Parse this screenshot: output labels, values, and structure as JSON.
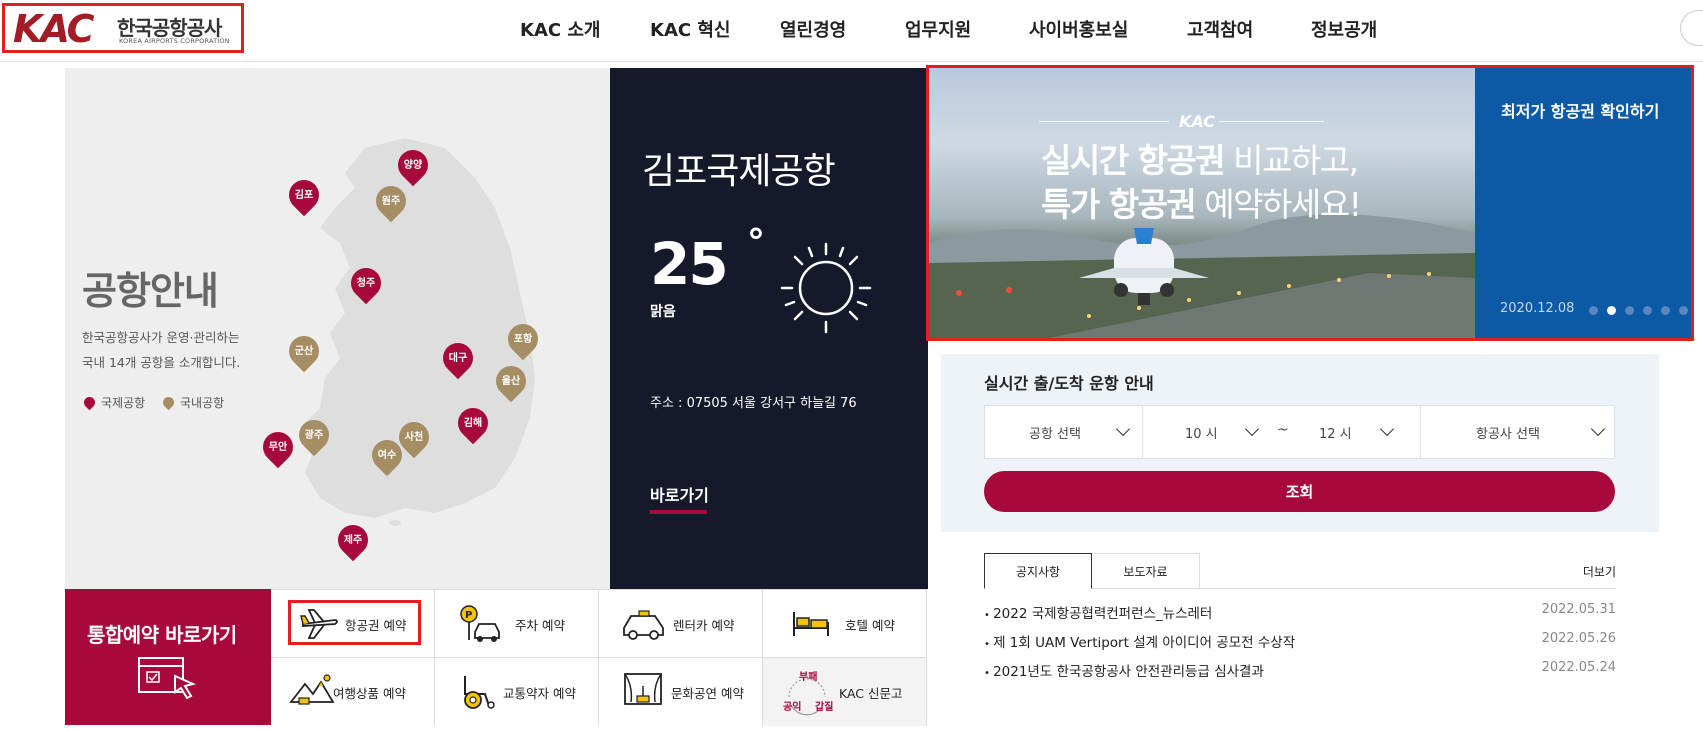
{
  "header": {
    "logo_mark": "KAC",
    "logo_korean": "한국공항공사",
    "logo_english": "KOREA AIRPORTS CORPORATION",
    "nav": [
      "KAC 소개",
      "KAC 혁신",
      "열린경영",
      "업무지원",
      "사이버홍보실",
      "고객참여",
      "정보공개"
    ]
  },
  "map_panel": {
    "title": "공항안내",
    "desc_line1": "한국공항공사가 운영·관리하는",
    "desc_line2": "국내 14개 공항을 소개합니다.",
    "legend_international": "국제공항",
    "legend_domestic": "국내공항",
    "airports": [
      {
        "name": "김포",
        "type": "international"
      },
      {
        "name": "양양",
        "type": "international"
      },
      {
        "name": "원주",
        "type": "domestic"
      },
      {
        "name": "청주",
        "type": "international"
      },
      {
        "name": "군산",
        "type": "domestic"
      },
      {
        "name": "포항",
        "type": "domestic"
      },
      {
        "name": "대구",
        "type": "international"
      },
      {
        "name": "울산",
        "type": "domestic"
      },
      {
        "name": "김해",
        "type": "international"
      },
      {
        "name": "광주",
        "type": "domestic"
      },
      {
        "name": "사천",
        "type": "domestic"
      },
      {
        "name": "무안",
        "type": "international"
      },
      {
        "name": "여수",
        "type": "domestic"
      },
      {
        "name": "제주",
        "type": "international"
      }
    ],
    "colors": {
      "international": "#a70a3a",
      "domestic": "#a68e64"
    }
  },
  "airport_panel": {
    "name": "김포국제공항",
    "temperature": "25",
    "degree_symbol": "°",
    "weather": "맑음",
    "address": "주소 : 07505 서울 강서구 하늘길 76",
    "shortcut": "바로가기"
  },
  "banner": {
    "mark": "KAC",
    "line1_bold": "실시간 항공권",
    "line1_rest": " 비교하고,",
    "line2_bold": "특가 항공권",
    "line2_rest": " 예약하세요!",
    "cta": "최저가 항공권 확인하기",
    "date": "2020.12.08",
    "slide_count": 6,
    "active_slide": 2,
    "accent_color": "#0c5aa6"
  },
  "flight_info": {
    "title": "실시간 출/도착 운항 안내",
    "airport_select": "공항 선택",
    "time_from": "10 시",
    "tilde": "~",
    "time_to": "12 시",
    "airline_select": "항공사 선택",
    "search_button": "조회"
  },
  "notice": {
    "tab_notice": "공지사항",
    "tab_press": "보도자료",
    "more": "더보기",
    "items": [
      {
        "title": "2022 국제항공협력컨퍼런스_뉴스레터",
        "date": "2022.05.31"
      },
      {
        "title": "제 1회 UAM Vertiport 설계 아이디어 공모전 수상작",
        "date": "2022.05.26"
      },
      {
        "title": "2021년도 한국공항공사 안전관리등급 심사결과",
        "date": "2022.05.24"
      }
    ]
  },
  "booking": {
    "title": "통합예약 바로가기",
    "items": [
      {
        "label": "항공권 예약",
        "icon": "airplane-icon"
      },
      {
        "label": "주차 예약",
        "icon": "parking-car-icon"
      },
      {
        "label": "렌터카 예약",
        "icon": "rental-car-icon"
      },
      {
        "label": "호텔 예약",
        "icon": "bed-icon"
      },
      {
        "label": "여행상품 예약",
        "icon": "mountain-travel-icon"
      },
      {
        "label": "교통약자 예약",
        "icon": "wheelchair-icon"
      },
      {
        "label": "문화공연 예약",
        "icon": "stage-icon"
      },
      {
        "label": "KAC 신문고",
        "icon": "anticorruption-icon"
      }
    ],
    "news_badge_top": "부패",
    "news_badge_left": "공익",
    "news_badge_right": "갑질",
    "brand_color": "#a70a3a"
  }
}
